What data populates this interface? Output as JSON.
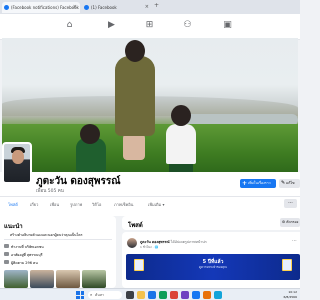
{
  "browser": {
    "tabs": [
      {
        "label": "(Facebook notifications) Facebook"
      },
      {
        "label": "(1) Facebook"
      }
    ],
    "new_tab_glyph": "+"
  },
  "fb_nav": {
    "icons": [
      "home-icon",
      "video-icon",
      "marketplace-icon",
      "groups-icon",
      "gaming-icon"
    ]
  },
  "profile": {
    "name": "ภูตะวัน ดองสุพรรณ์",
    "friends": "เพื่อน 505 คน",
    "primary_button": "เพิ่มในเรื่องราว",
    "secondary_button": "แก้ไข",
    "tabs": [
      "โพสต์",
      "เกี่ยว",
      "เพื่อน",
      "รูปภาพ",
      "วิดีโอ",
      "ภาพเช็คอิน",
      "เพิ่มเติม"
    ],
    "more_glyph": "···"
  },
  "intro": {
    "title": "แนะนำ",
    "bio": "สร้างคำอธิบายตัวเองและบอกผู้คนว่าคุณเป็นใคร",
    "rows": [
      "ทำงานที่ บริษัทเอกชน",
      "อาศัยอยู่ที่ สุพรรณบุรี",
      "ผู้ติดตาม 296 คน"
    ]
  },
  "posts": {
    "title": "โพสต์",
    "filter_button": "ตัวกรอง",
    "post": {
      "author": "ภูตะวัน ดองสุพรรณ์",
      "action": "ได้อัปเดตรูปภาพหน้าปก",
      "date": "1 ชั่วโมง · 🌐",
      "more_glyph": "···",
      "banner_title": "5 ปีที่แล้ว",
      "banner_sub": "ดูความทรงจำของคุณ"
    }
  },
  "taskbar": {
    "search_label": "ค้นหา",
    "time": "10:12",
    "date": "6/8/2566"
  },
  "colors": {
    "fb_blue": "#1877f2",
    "banner_blue": "#1438b8",
    "page_bg": "#f0f2f5"
  }
}
